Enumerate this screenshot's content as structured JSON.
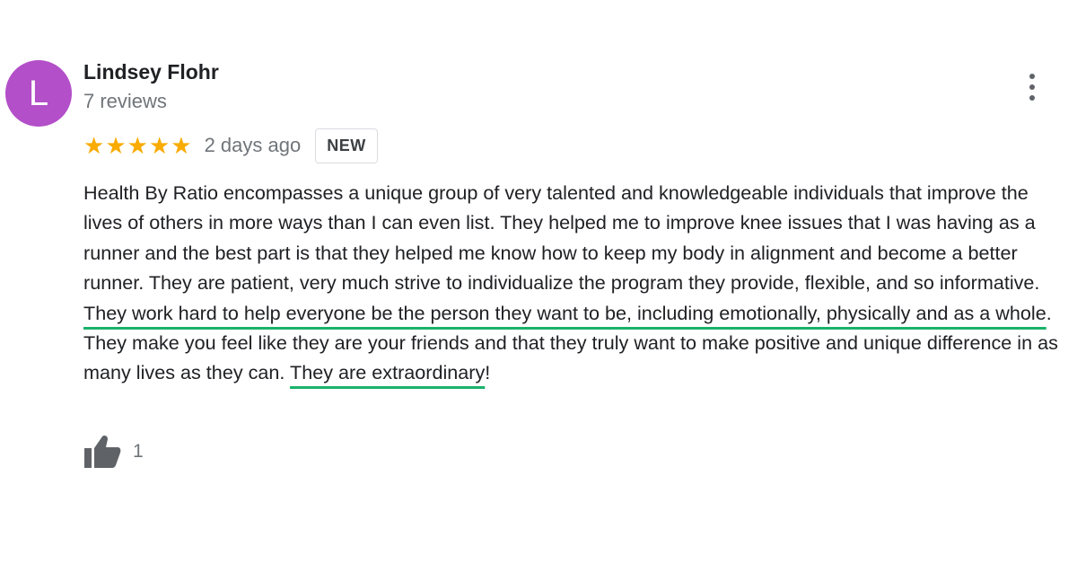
{
  "review": {
    "avatar_initial": "L",
    "avatar_color": "#b34fc8",
    "author_name": "Lindsey Flohr",
    "author_reviews": "7 reviews",
    "rating": 5,
    "star_glyph": "★",
    "time_ago": "2 days ago",
    "badge": "NEW",
    "text_parts": [
      "Health By Ratio encompasses a unique group of very talented and knowledgeable individuals that improve the lives of others in more ways than I can even list. They helped me to improve knee issues that I was having as a runner and the best part is that they helped me know how to keep my body in alignment and become a better runner. They are patient, very much strive to individualize the program they provide, flexible, and so informative. ",
      "They work hard to help everyone be the person they want to be, including emotionally, physically and as a whole",
      ". They make you feel like they are your friends and that they truly want to make positive and unique difference in as many lives as they can. ",
      "They are extraordinary",
      "!"
    ],
    "likes": "1"
  },
  "icons": {
    "more": "more-vert-icon",
    "like": "thumb-up-icon",
    "star": "star-icon"
  },
  "colors": {
    "star": "#f9ab00",
    "highlight_underline": "#1ab26b",
    "secondary_text": "#70757a"
  }
}
